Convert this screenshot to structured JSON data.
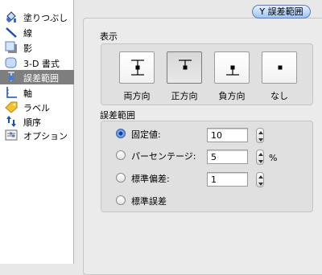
{
  "sidebar": {
    "items": [
      {
        "label": "塗りつぶし",
        "icon": "paint-bucket-icon",
        "selected": false
      },
      {
        "label": "線",
        "icon": "line-icon",
        "selected": false
      },
      {
        "label": "影",
        "icon": "shadow-icon",
        "selected": false
      },
      {
        "label": "3-D 書式",
        "icon": "3d-format-icon",
        "selected": false
      },
      {
        "label": "誤差範囲",
        "icon": "error-bars-icon",
        "selected": true
      },
      {
        "label": "軸",
        "icon": "axis-icon",
        "selected": false
      },
      {
        "label": "ラベル",
        "icon": "label-tag-icon",
        "selected": false
      },
      {
        "label": "順序",
        "icon": "order-icon",
        "selected": false
      },
      {
        "label": "オプション",
        "icon": "options-icon",
        "selected": false
      }
    ]
  },
  "header": {
    "tab_label": "Y 誤差範囲"
  },
  "display": {
    "title": "表示",
    "directions": [
      {
        "label": "両方向",
        "icon": "both-direction-icon",
        "selected": false
      },
      {
        "label": "正方向",
        "icon": "plus-direction-icon",
        "selected": true
      },
      {
        "label": "負方向",
        "icon": "minus-direction-icon",
        "selected": false
      },
      {
        "label": "なし",
        "icon": "none-direction-icon",
        "selected": false
      }
    ]
  },
  "error_amount": {
    "title": "誤差範囲",
    "options": [
      {
        "label": "固定値:",
        "value": "10",
        "unit": "",
        "selected": true
      },
      {
        "label": "パーセンテージ:",
        "value": "5",
        "unit": "%",
        "selected": false
      },
      {
        "label": "標準偏差:",
        "value": "1",
        "unit": "",
        "selected": false
      },
      {
        "label": "標準誤差",
        "value": null,
        "unit": "",
        "selected": false
      }
    ]
  },
  "colors": {
    "selected_row": "#7e7e7e",
    "accent": "#5a7fb8"
  }
}
